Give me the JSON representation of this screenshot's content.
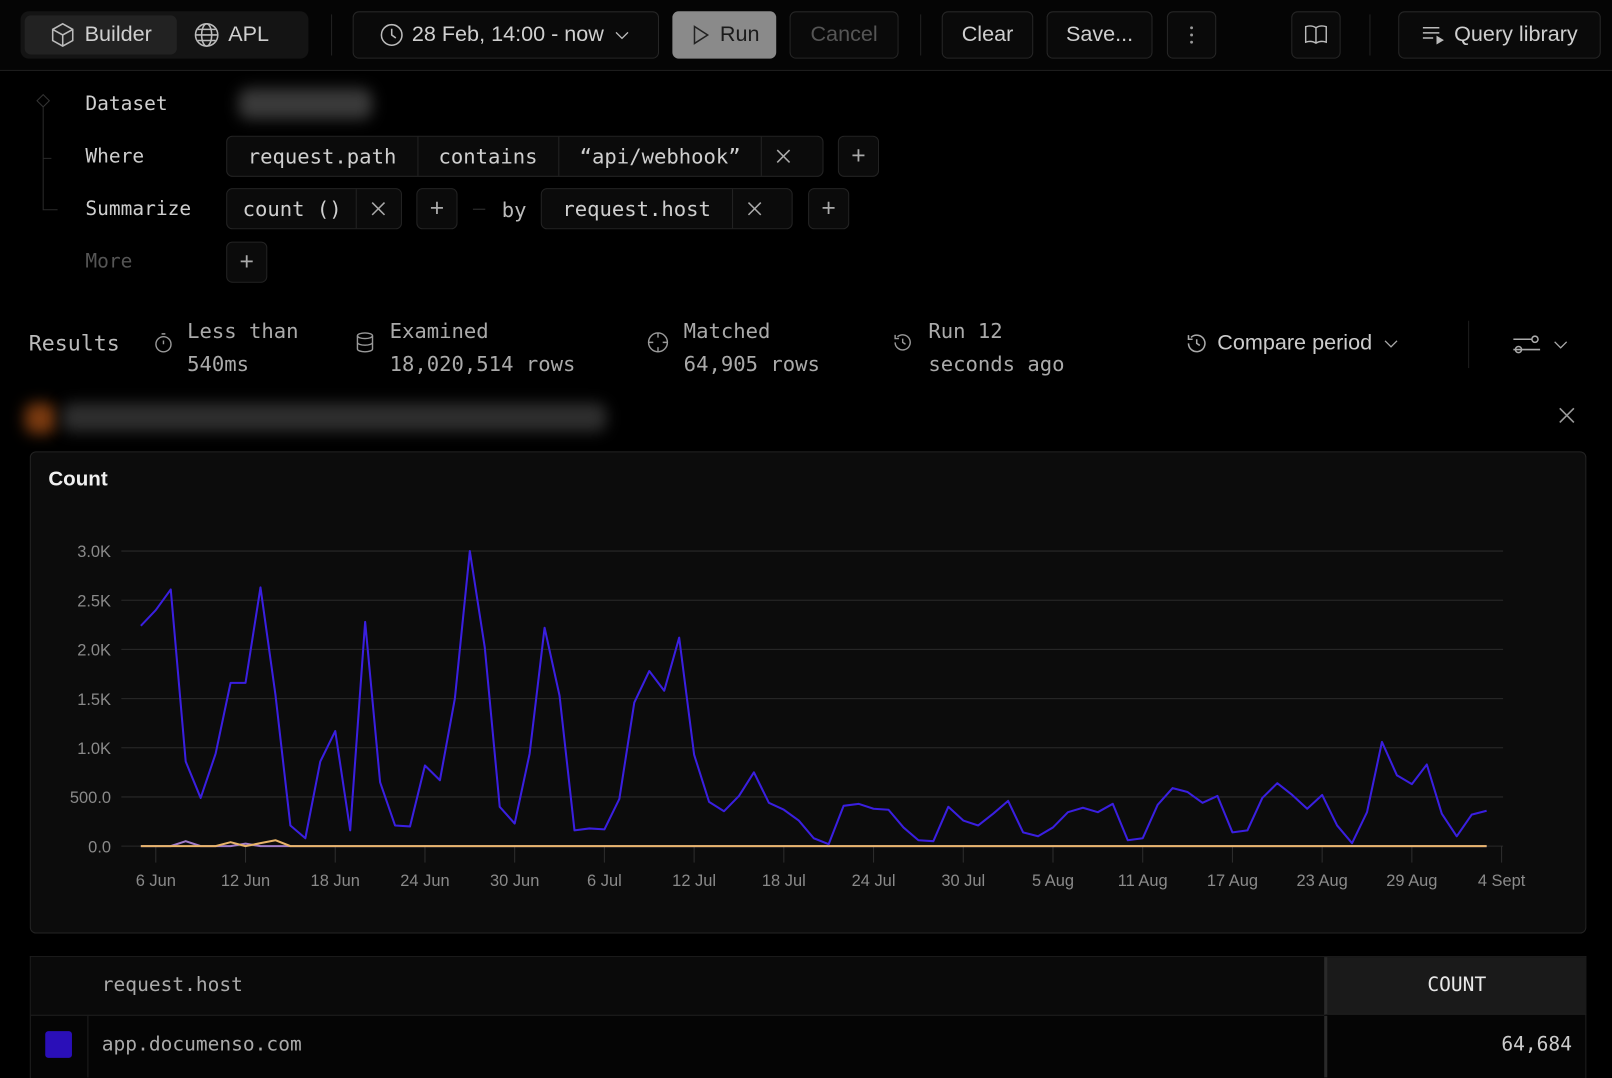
{
  "toolbar": {
    "mode_tabs": [
      {
        "label": "Builder",
        "icon": "cube-icon",
        "active": true
      },
      {
        "label": "APL",
        "icon": "globe-icon",
        "active": false
      }
    ],
    "time_range": "28 Feb, 14:00 - now",
    "run_label": "Run",
    "cancel_label": "Cancel",
    "clear_label": "Clear",
    "save_label": "Save...",
    "more_icon": "vertical-dots-icon",
    "docs_icon": "book-icon",
    "query_library_label": "Query library"
  },
  "query": {
    "dataset_label": "Dataset",
    "where_label": "Where",
    "where_field": "request.path",
    "where_operator": "contains",
    "where_value": "“api/webhook”",
    "summarize_label": "Summarize",
    "summarize_fn": "count",
    "summarize_args": "()",
    "by_label": "by",
    "group_by": "request.host",
    "more_label": "More"
  },
  "results": {
    "title": "Results",
    "duration_line1": "Less than",
    "duration_line2": "540ms",
    "examined_line1": "Examined",
    "examined_line2": "18,020,514 rows",
    "matched_line1": "Matched",
    "matched_line2": "64,905 rows",
    "run_line1": "Run 12",
    "run_line2": "seconds ago",
    "compare_label": "Compare period"
  },
  "colors": {
    "accent_series": "#3a1fe0",
    "swatch": "#2a0fb8",
    "minor_orange": "#e8b46a",
    "minor_purple": "#a07cc8",
    "grid": "#2a2a2a"
  },
  "chart_data": {
    "type": "line",
    "title": "Count",
    "xlabel": "",
    "ylabel": "",
    "ylim": [
      0,
      3000
    ],
    "yticks": [
      "0.0",
      "500.0",
      "1.0K",
      "1.5K",
      "2.0K",
      "2.5K",
      "3.0K"
    ],
    "ytick_values": [
      0,
      500,
      1000,
      1500,
      2000,
      2500,
      3000
    ],
    "xtick_labels": [
      "6 Jun",
      "12 Jun",
      "18 Jun",
      "24 Jun",
      "30 Jun",
      "6 Jul",
      "12 Jul",
      "18 Jul",
      "24 Jul",
      "30 Jul",
      "5 Aug",
      "11 Aug",
      "17 Aug",
      "23 Aug",
      "29 Aug",
      "4 Sept"
    ],
    "grid": true,
    "x": [
      "5 Jun",
      "6 Jun",
      "7 Jun",
      "8 Jun",
      "9 Jun",
      "10 Jun",
      "11 Jun",
      "12 Jun",
      "13 Jun",
      "14 Jun",
      "15 Jun",
      "16 Jun",
      "17 Jun",
      "18 Jun",
      "19 Jun",
      "20 Jun",
      "21 Jun",
      "22 Jun",
      "23 Jun",
      "24 Jun",
      "25 Jun",
      "26 Jun",
      "27 Jun",
      "28 Jun",
      "29 Jun",
      "30 Jun",
      "1 Jul",
      "2 Jul",
      "3 Jul",
      "4 Jul",
      "5 Jul",
      "6 Jul",
      "7 Jul",
      "8 Jul",
      "9 Jul",
      "10 Jul",
      "11 Jul",
      "12 Jul",
      "13 Jul",
      "14 Jul",
      "15 Jul",
      "16 Jul",
      "17 Jul",
      "18 Jul",
      "19 Jul",
      "20 Jul",
      "21 Jul",
      "22 Jul",
      "23 Jul",
      "24 Jul",
      "25 Jul",
      "26 Jul",
      "27 Jul",
      "28 Jul",
      "29 Jul",
      "30 Jul",
      "31 Jul",
      "1 Aug",
      "2 Aug",
      "3 Aug",
      "4 Aug",
      "5 Aug",
      "6 Aug",
      "7 Aug",
      "8 Aug",
      "9 Aug",
      "10 Aug",
      "11 Aug",
      "12 Aug",
      "13 Aug",
      "14 Aug",
      "15 Aug",
      "16 Aug",
      "17 Aug",
      "18 Aug",
      "19 Aug",
      "20 Aug",
      "21 Aug",
      "22 Aug",
      "23 Aug",
      "24 Aug",
      "25 Aug",
      "26 Aug",
      "27 Aug",
      "28 Aug",
      "29 Aug",
      "30 Aug",
      "31 Aug",
      "1 Sept",
      "2 Sept",
      "3 Sept"
    ],
    "series": [
      {
        "color": "#3a1fe0",
        "values": [
          2240,
          2400,
          2610,
          860,
          490,
          940,
          1660,
          1660,
          2630,
          1540,
          210,
          80,
          860,
          1170,
          160,
          2280,
          650,
          210,
          200,
          820,
          670,
          1500,
          3000,
          2020,
          400,
          230,
          940,
          2220,
          1530,
          160,
          180,
          170,
          480,
          1460,
          1780,
          1580,
          2120,
          930,
          450,
          355,
          510,
          750,
          440,
          370,
          260,
          80,
          20,
          410,
          430,
          380,
          370,
          190,
          60,
          50,
          400,
          260,
          210,
          330,
          460,
          140,
          100,
          190,
          345,
          390,
          345,
          430,
          60,
          80,
          420,
          590,
          550,
          440,
          510,
          140,
          160,
          490,
          640,
          520,
          380,
          520,
          210,
          30,
          345,
          1060,
          720,
          630,
          830,
          330,
          100,
          320,
          360
        ]
      },
      {
        "color": "#a07cc8",
        "values": [
          0,
          0,
          0,
          50,
          0,
          0,
          0,
          25,
          0,
          0,
          0,
          0,
          0,
          0,
          0,
          0,
          0,
          0,
          0,
          0,
          0,
          0,
          0,
          0,
          0,
          0,
          0,
          0,
          0,
          0,
          0,
          0,
          0,
          0,
          0,
          0,
          0,
          0,
          0,
          0,
          0,
          0,
          0,
          0,
          0,
          0,
          0,
          0,
          0,
          0,
          0,
          0,
          0,
          0,
          0,
          0,
          0,
          0,
          0,
          0,
          0,
          0,
          0,
          0,
          0,
          0,
          0,
          0,
          0,
          0,
          0,
          0,
          0,
          0,
          0,
          0,
          0,
          0,
          0,
          0,
          0,
          0,
          0,
          0,
          0,
          0,
          0,
          0,
          0,
          0,
          0
        ]
      },
      {
        "color": "#e8b46a",
        "values": [
          0,
          0,
          0,
          0,
          0,
          0,
          40,
          0,
          30,
          60,
          0,
          0,
          0,
          0,
          0,
          0,
          0,
          0,
          0,
          0,
          0,
          0,
          0,
          0,
          0,
          0,
          0,
          0,
          0,
          0,
          0,
          0,
          0,
          0,
          0,
          0,
          0,
          0,
          0,
          0,
          0,
          0,
          0,
          0,
          0,
          0,
          0,
          0,
          0,
          0,
          0,
          0,
          0,
          0,
          0,
          0,
          0,
          0,
          0,
          0,
          0,
          0,
          0,
          0,
          0,
          0,
          0,
          0,
          0,
          0,
          0,
          0,
          0,
          0,
          0,
          0,
          0,
          0,
          0,
          0,
          0,
          0,
          0,
          0,
          0,
          0,
          0,
          0,
          0,
          0,
          0
        ]
      }
    ]
  },
  "table": {
    "columns": [
      "request.host",
      "COUNT"
    ],
    "rows": [
      {
        "host": "app.documenso.com",
        "count": "64,684",
        "color": "#2a0fb8"
      }
    ]
  }
}
